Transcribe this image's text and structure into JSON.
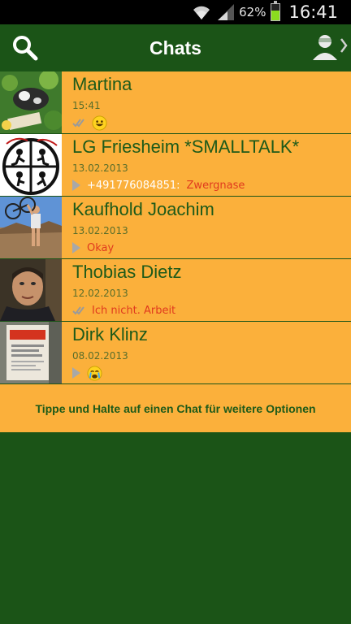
{
  "status_bar": {
    "battery_percent": "62%",
    "battery_level": 0.62,
    "time": "16:41"
  },
  "header": {
    "title": "Chats",
    "left_icon": "search-icon",
    "right_icon": "contact-icon"
  },
  "colors": {
    "bar_green": "#1b5417",
    "row_orange": "#fbb03b",
    "name_green": "#1e5a19",
    "preview_red": "#e03a1e"
  },
  "chats": [
    {
      "name": "Martina",
      "time": "15:41",
      "status_icon": "double-check-icon",
      "sender": "",
      "preview": "",
      "emoji": "smiling-face-icon"
    },
    {
      "name": "LG Friesheim *SMALLTALK*",
      "time": "13.02.2013",
      "status_icon": "play-icon",
      "sender": "+491776084851:",
      "preview": "Zwergnase",
      "emoji": ""
    },
    {
      "name": "Kaufhold Joachim",
      "time": "13.02.2013",
      "status_icon": "play-icon",
      "sender": "",
      "preview": "Okay",
      "emoji": ""
    },
    {
      "name": "Thobias Dietz",
      "time": "12.02.2013",
      "status_icon": "double-check-icon",
      "sender": "",
      "preview": "Ich nicht. Arbeit",
      "emoji": ""
    },
    {
      "name": "Dirk Klinz",
      "time": "08.02.2013",
      "status_icon": "play-icon",
      "sender": "",
      "preview": "",
      "emoji": "crying-face-icon"
    }
  ],
  "hint_text": "Tippe und Halte auf einen Chat für weitere Optionen"
}
